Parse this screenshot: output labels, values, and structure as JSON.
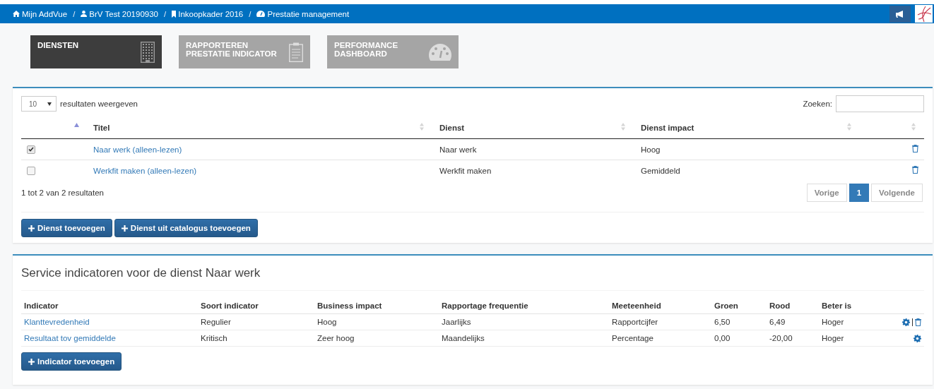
{
  "breadcrumb_separator": "/",
  "breadcrumbs": [
    "Mijn AddVue",
    "BrV Test 20190930",
    "Inkoopkader 2016",
    "Prestatie management"
  ],
  "tiles": [
    {
      "lines": [
        "DIENSTEN"
      ],
      "selected": true
    },
    {
      "lines": [
        "RAPPORTEREN",
        "PRESTATIE INDICATOR"
      ],
      "selected": false
    },
    {
      "lines": [
        "PERFORMANCE",
        "DASHBOARD"
      ],
      "selected": false
    }
  ],
  "services": {
    "page_length": "10",
    "length_label": "resultaten weergeven",
    "search_label": "Zoeken:",
    "columns": [
      "Titel",
      "Dienst",
      "Dienst impact"
    ],
    "rows": [
      {
        "checked": true,
        "title": "Naar werk (alleen-lezen)",
        "dienst": "Naar werk",
        "impact": "Hoog"
      },
      {
        "checked": false,
        "title": "Werkfit maken (alleen-lezen)",
        "dienst": "Werkfit maken",
        "impact": "Gemiddeld"
      }
    ],
    "info": "1 tot 2 van 2 resultaten",
    "pagination": [
      {
        "label": "Vorige",
        "selected": false
      },
      {
        "label": "1",
        "selected": true
      },
      {
        "label": "Volgende",
        "selected": false
      }
    ],
    "buttons": [
      "Dienst toevoegen",
      "Dienst uit catalogus toevoegen"
    ]
  },
  "indicators": {
    "title": "Service indicatoren voor de dienst Naar werk",
    "columns": [
      "Indicator",
      "Soort indicator",
      "Business impact",
      "Rapportage frequentie",
      "Meeteenheid",
      "Groen",
      "Rood",
      "Beter is"
    ],
    "rows": [
      {
        "cells": [
          "Klanttevredenheid",
          "Regulier",
          "Hoog",
          "Jaarlijks",
          "Rapportcijfer",
          "6,50",
          "6,49",
          "Hoger"
        ],
        "deletable": true
      },
      {
        "cells": [
          "Resultaat tov gemiddelde",
          "Kritisch",
          "Zeer hoog",
          "Maandelijks",
          "Percentage",
          "0,00",
          "-20,00",
          "Hoger"
        ],
        "deletable": false
      }
    ],
    "button": "Indicator toevoegen"
  }
}
